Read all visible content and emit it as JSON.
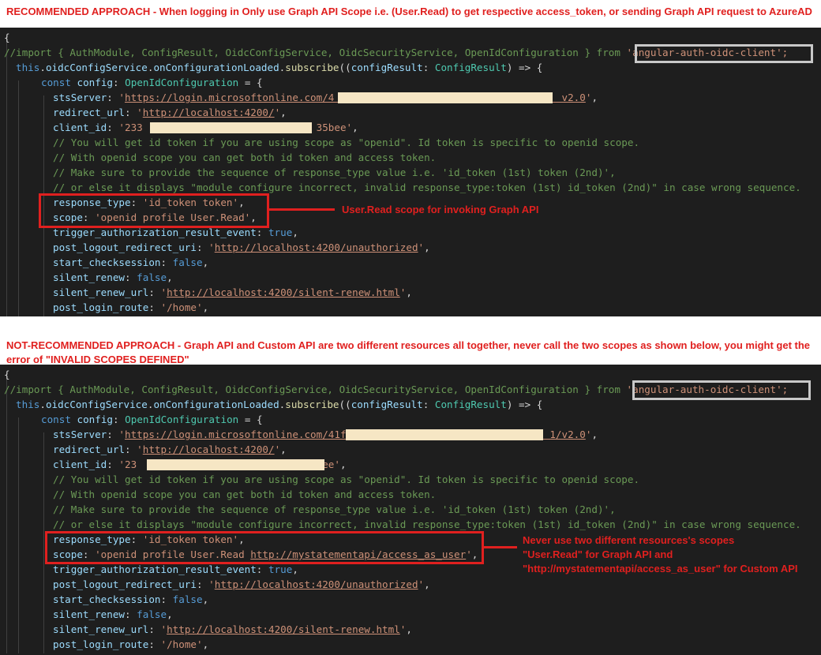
{
  "top": {
    "heading": "RECOMMENDED APPROACH - When logging in Only use Graph API Scope i.e. (User.Read) to get respective access_token, or sending Graph API request to AzureAD",
    "annotation": "User.Read scope for invoking Graph API",
    "lines": [
      [
        [
          "pn",
          "{"
        ]
      ],
      [
        [
          "cm",
          "//import { AuthModule, ConfigResult, OidcConfigService, OidcSecurityService, OpenIdConfiguration } from "
        ],
        [
          "st",
          "'angular-auth-oidc-client';"
        ]
      ],
      [
        [
          "kw",
          "this"
        ],
        [
          "pn",
          "."
        ],
        [
          "ky",
          "oidcConfigService"
        ],
        [
          "pn",
          "."
        ],
        [
          "ky",
          "onConfigurationLoaded"
        ],
        [
          "pn",
          "."
        ],
        [
          "fn",
          "subscribe"
        ],
        [
          "pn",
          "(("
        ],
        [
          "ky",
          "configResult"
        ],
        [
          "pn",
          ": "
        ],
        [
          "ty",
          "ConfigResult"
        ],
        [
          "pn",
          ") => {"
        ]
      ],
      [
        [
          "kw",
          "const "
        ],
        [
          "ky",
          "config"
        ],
        [
          "pn",
          ": "
        ],
        [
          "ty",
          "OpenIdConfiguration"
        ],
        [
          "pn",
          " = {"
        ]
      ],
      [
        [
          "ky",
          "stsServer"
        ],
        [
          "pn",
          ": "
        ],
        [
          "st",
          "'"
        ],
        [
          "url",
          "https://login.microsoftonline.com/4                                      v2.0"
        ],
        [
          "st",
          "'"
        ],
        [
          "pn",
          ","
        ]
      ],
      [
        [
          "ky",
          "redirect_url"
        ],
        [
          "pn",
          ": "
        ],
        [
          "st",
          "'"
        ],
        [
          "url",
          "http://localhost:4200/"
        ],
        [
          "st",
          "'"
        ],
        [
          "pn",
          ","
        ]
      ],
      [
        [
          "ky",
          "client_id"
        ],
        [
          "pn",
          ": "
        ],
        [
          "st",
          "'233                             35bee'"
        ],
        [
          "pn",
          ","
        ]
      ],
      [
        [
          "cm",
          "// You will get id token if you are using scope as \"openid\". Id token is specific to openid scope."
        ]
      ],
      [
        [
          "cm",
          "// With openid scope you can get both id token and access token."
        ]
      ],
      [
        [
          "cm",
          "// Make sure to provide the sequence of response_type value i.e. 'id_token (1st) token (2nd)',"
        ]
      ],
      [
        [
          "cm",
          "// or else it displays \"module configure incorrect, invalid response_type:token (1st) id_token (2nd)\" in case wrong sequence."
        ]
      ],
      [
        [
          "ky",
          "response_type"
        ],
        [
          "pn",
          ": "
        ],
        [
          "st",
          "'id_token token'"
        ],
        [
          "pn",
          ","
        ]
      ],
      [
        [
          "ky",
          "scope"
        ],
        [
          "pn",
          ": "
        ],
        [
          "st",
          "'openid profile User.Read'"
        ],
        [
          "pn",
          ","
        ]
      ],
      [
        [
          "ky",
          "trigger_authorization_result_event"
        ],
        [
          "pn",
          ": "
        ],
        [
          "kw",
          "true"
        ],
        [
          "pn",
          ","
        ]
      ],
      [
        [
          "ky",
          "post_logout_redirect_uri"
        ],
        [
          "pn",
          ": "
        ],
        [
          "st",
          "'"
        ],
        [
          "url",
          "http://localhost:4200/unauthorized"
        ],
        [
          "st",
          "'"
        ],
        [
          "pn",
          ","
        ]
      ],
      [
        [
          "ky",
          "start_checksession"
        ],
        [
          "pn",
          ": "
        ],
        [
          "kw",
          "false"
        ],
        [
          "pn",
          ","
        ]
      ],
      [
        [
          "ky",
          "silent_renew"
        ],
        [
          "pn",
          ": "
        ],
        [
          "kw",
          "false"
        ],
        [
          "pn",
          ","
        ]
      ],
      [
        [
          "ky",
          "silent_renew_url"
        ],
        [
          "pn",
          ": "
        ],
        [
          "st",
          "'"
        ],
        [
          "url",
          "http://localhost:4200/silent-renew.html"
        ],
        [
          "st",
          "'"
        ],
        [
          "pn",
          ","
        ]
      ],
      [
        [
          "ky",
          "post_login_route"
        ],
        [
          "pn",
          ": "
        ],
        [
          "st",
          "'/home'"
        ],
        [
          "pn",
          ","
        ]
      ]
    ]
  },
  "bottom": {
    "heading_line1": "NOT-RECOMMENDED APPROACH - Graph API and Custom API are two different resources all together, never call the two scopes as shown below, you might get the",
    "heading_line2": "error of \"INVALID SCOPES DEFINED\"",
    "annotation": [
      "Never use two different resources's scopes",
      "\"User.Read\" for Graph API and",
      "\"http://mystatementapi/access_as_user\" for Custom API"
    ],
    "lines": [
      [
        [
          "pn",
          "{"
        ]
      ],
      [
        [
          "cm",
          "//import { AuthModule, ConfigResult, OidcConfigService, OidcSecurityService, OpenIdConfiguration } from "
        ],
        [
          "st",
          "'angular-auth-oidc-client';"
        ]
      ],
      [
        [
          "kw",
          "this"
        ],
        [
          "pn",
          "."
        ],
        [
          "ky",
          "oidcConfigService"
        ],
        [
          "pn",
          "."
        ],
        [
          "ky",
          "onConfigurationLoaded"
        ],
        [
          "pn",
          "."
        ],
        [
          "fn",
          "subscribe"
        ],
        [
          "pn",
          "(("
        ],
        [
          "ky",
          "configResult"
        ],
        [
          "pn",
          ": "
        ],
        [
          "ty",
          "ConfigResult"
        ],
        [
          "pn",
          ") => {"
        ]
      ],
      [
        [
          "kw",
          "const "
        ],
        [
          "ky",
          "config"
        ],
        [
          "pn",
          ": "
        ],
        [
          "ty",
          "OpenIdConfiguration"
        ],
        [
          "pn",
          " = {"
        ]
      ],
      [
        [
          "ky",
          "stsServer"
        ],
        [
          "pn",
          ": "
        ],
        [
          "st",
          "'"
        ],
        [
          "url",
          "https://login.microsoftonline.com/41f                                  1/v2.0"
        ],
        [
          "st",
          "'"
        ],
        [
          "pn",
          ","
        ]
      ],
      [
        [
          "ky",
          "redirect_url"
        ],
        [
          "pn",
          ": "
        ],
        [
          "st",
          "'"
        ],
        [
          "url",
          "http://localhost:4200/"
        ],
        [
          "st",
          "'"
        ],
        [
          "pn",
          ","
        ]
      ],
      [
        [
          "ky",
          "client_id"
        ],
        [
          "pn",
          ": "
        ],
        [
          "st",
          "'23                               ee'"
        ],
        [
          "pn",
          ","
        ]
      ],
      [
        [
          "cm",
          "// You will get id token if you are using scope as \"openid\". Id token is specific to openid scope."
        ]
      ],
      [
        [
          "cm",
          "// With openid scope you can get both id token and access token."
        ]
      ],
      [
        [
          "cm",
          "// Make sure to provide the sequence of response_type value i.e. 'id_token (1st) token (2nd)',"
        ]
      ],
      [
        [
          "cm",
          "// or else it displays \"module configure incorrect, invalid response_type:token (1st) id_token (2nd)\" in case wrong sequence."
        ]
      ],
      [
        [
          "ky",
          "response_type"
        ],
        [
          "pn",
          ": "
        ],
        [
          "st",
          "'id_token token'"
        ],
        [
          "pn",
          ","
        ]
      ],
      [
        [
          "ky",
          "scope"
        ],
        [
          "pn",
          ": "
        ],
        [
          "st",
          "'openid profile User.Read "
        ],
        [
          "url",
          "http://mystatementapi/access_as_user"
        ],
        [
          "st",
          "'"
        ],
        [
          "pn",
          ","
        ]
      ],
      [
        [
          "ky",
          "trigger_authorization_result_event"
        ],
        [
          "pn",
          ": "
        ],
        [
          "kw",
          "true"
        ],
        [
          "pn",
          ","
        ]
      ],
      [
        [
          "ky",
          "post_logout_redirect_uri"
        ],
        [
          "pn",
          ": "
        ],
        [
          "st",
          "'"
        ],
        [
          "url",
          "http://localhost:4200/unauthorized"
        ],
        [
          "st",
          "'"
        ],
        [
          "pn",
          ","
        ]
      ],
      [
        [
          "ky",
          "start_checksession"
        ],
        [
          "pn",
          ": "
        ],
        [
          "kw",
          "false"
        ],
        [
          "pn",
          ","
        ]
      ],
      [
        [
          "ky",
          "silent_renew"
        ],
        [
          "pn",
          ": "
        ],
        [
          "kw",
          "false"
        ],
        [
          "pn",
          ","
        ]
      ],
      [
        [
          "ky",
          "silent_renew_url"
        ],
        [
          "pn",
          ": "
        ],
        [
          "st",
          "'"
        ],
        [
          "url",
          "http://localhost:4200/silent-renew.html"
        ],
        [
          "st",
          "'"
        ],
        [
          "pn",
          ","
        ]
      ],
      [
        [
          "ky",
          "post_login_route"
        ],
        [
          "pn",
          ": "
        ],
        [
          "st",
          "'/home'"
        ],
        [
          "pn",
          ","
        ]
      ]
    ]
  }
}
